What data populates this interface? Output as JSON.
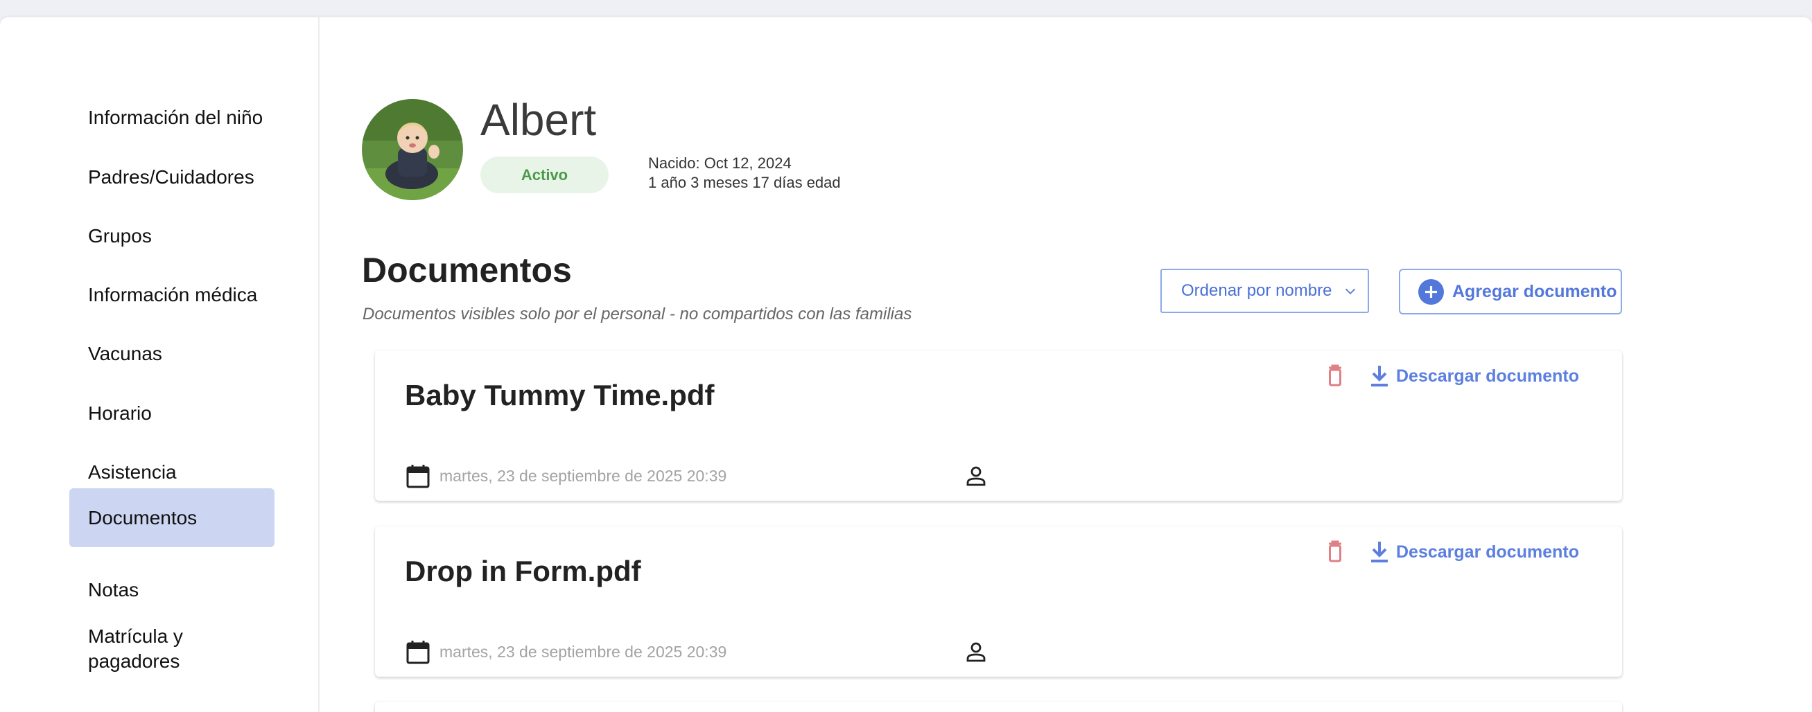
{
  "sidebar": {
    "items": [
      {
        "label": "Información del niño"
      },
      {
        "label": "Padres/Cuidadores"
      },
      {
        "label": "Grupos"
      },
      {
        "label": "Información médica"
      },
      {
        "label": "Vacunas"
      },
      {
        "label": "Horario"
      },
      {
        "label": "Asistencia"
      },
      {
        "label": "Documentos",
        "active": true
      },
      {
        "label": "Notas"
      },
      {
        "label": "Matrícula y pagadores"
      }
    ]
  },
  "child": {
    "name": "Albert",
    "status": "Activo",
    "born": "Nacido: Oct 12, 2024",
    "age": "1 año 3 meses 17 días edad"
  },
  "documents_section": {
    "title": "Documentos",
    "subtitle": "Documentos visibles solo por el personal - no compartidos con las familias",
    "sort_value": "Ordenar por nombre",
    "add_label": "Agregar documento",
    "download_label": "Descargar documento"
  },
  "documents": [
    {
      "name": "Baby Tummy Time.pdf",
      "date": "martes, 23 de septiembre de 2025 20:39"
    },
    {
      "name": "Drop in Form.pdf",
      "date": "martes, 23 de septiembre de 2025 20:39"
    }
  ],
  "colors": {
    "accent": "#5378dc",
    "active_nav": "#ccd6f2",
    "status_bg": "#e9f4e8",
    "status_text": "#4b9a49",
    "delete": "#e07f86"
  }
}
